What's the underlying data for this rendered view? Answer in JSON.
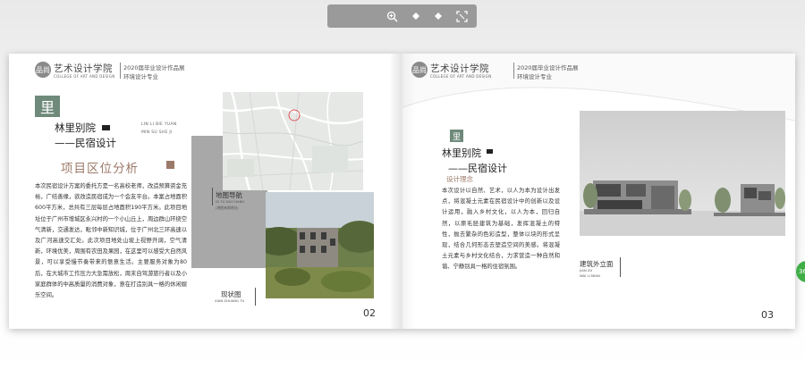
{
  "toolbar": {
    "buttons": [
      {
        "icon": "zoom-in-icon",
        "glyph": "⊕"
      },
      {
        "icon": "previous-page-icon",
        "glyph": "◆"
      },
      {
        "icon": "next-page-icon",
        "glyph": "◆"
      },
      {
        "icon": "fullscreen-icon",
        "glyph": "⛶"
      }
    ]
  },
  "header": {
    "logo_mark": "品尚",
    "school": "艺术设计学院",
    "school_en": "COLLEGE OF ART AND DESIGN",
    "line1": "2020届毕业设计作品展",
    "line2": "环境设计专业"
  },
  "left_page": {
    "badge_char": "里",
    "title1": "林里别院",
    "title1_pinyin_1": "LIN LI BIE YUAN",
    "title1_pinyin_2": "MIN SU SHE JI",
    "title2": "——民宿设计",
    "section_title": "项目区位分析",
    "body": "本次民宿设计方案的委托方是一名高校老师，改造预算资金充裕，广结善缘，欲改造民宿成为一个会友平台。本案占地面积600平方米，总共有三层每层占地面积190平方米。此项目地址位于广州市增城区永兴村的一个小山丘上，周边群山环绕空气清新，交通发达，毗邻中新知识城，位于广州北三环高速以及广河高速交汇处。此次项目地处山坡上视野开阔，空气清新，环境优美，周围有农田及果园，在这里可以感受大自然风景，可以享受慢节奏带来的愜意生活。主要服务对象为80后，在大城市工作压力大急需放松，周末自驾游旅行者以及小家庭群体的中高质量的消费对象，意在打造别具一格的休闲娱乐空间。",
    "map_caption": "地图导航",
    "map_caption_en": "DI TU DAO HANG",
    "map_caption_note": "(地图来源地址)",
    "photo_caption": "现状图",
    "photo_caption_en": "XIAN ZHUANG TU",
    "page_number": "02"
  },
  "right_page": {
    "badge_char": "里",
    "title1": "林里别院",
    "title2": "——民宿设计",
    "section_title": "设计理念",
    "body": "本次设计以自然、艺术，以人为本为设计出发点，将混凝土元素在民宿设计中的创新以及设计运用，融入乡村文化，以人为本，回归自然，以原毛胚建筑为基础，发挥混凝土的特性，抛去繁杂的色彩造型，整体以块的形式呈现，结合几何形态去塑造空间的美感。将混凝土元素与乡村文化结合，力求营造一种自然和谐、宁静别具一格的住宿氛围。",
    "render_caption": "建筑外立面",
    "render_caption_en_1": "JIAN ZU",
    "render_caption_en_2": "WAI LI MIAN",
    "page_number": "03",
    "side_tab": "36"
  },
  "colors": {
    "accent_brown": "#9c7a6a",
    "badge_green": "#6f8a7b",
    "map_bg": "#e8e8e8",
    "gray_box": "#a8a8a8",
    "toolbar": "#9a9a9a",
    "side_tab_green": "#3fae47"
  }
}
